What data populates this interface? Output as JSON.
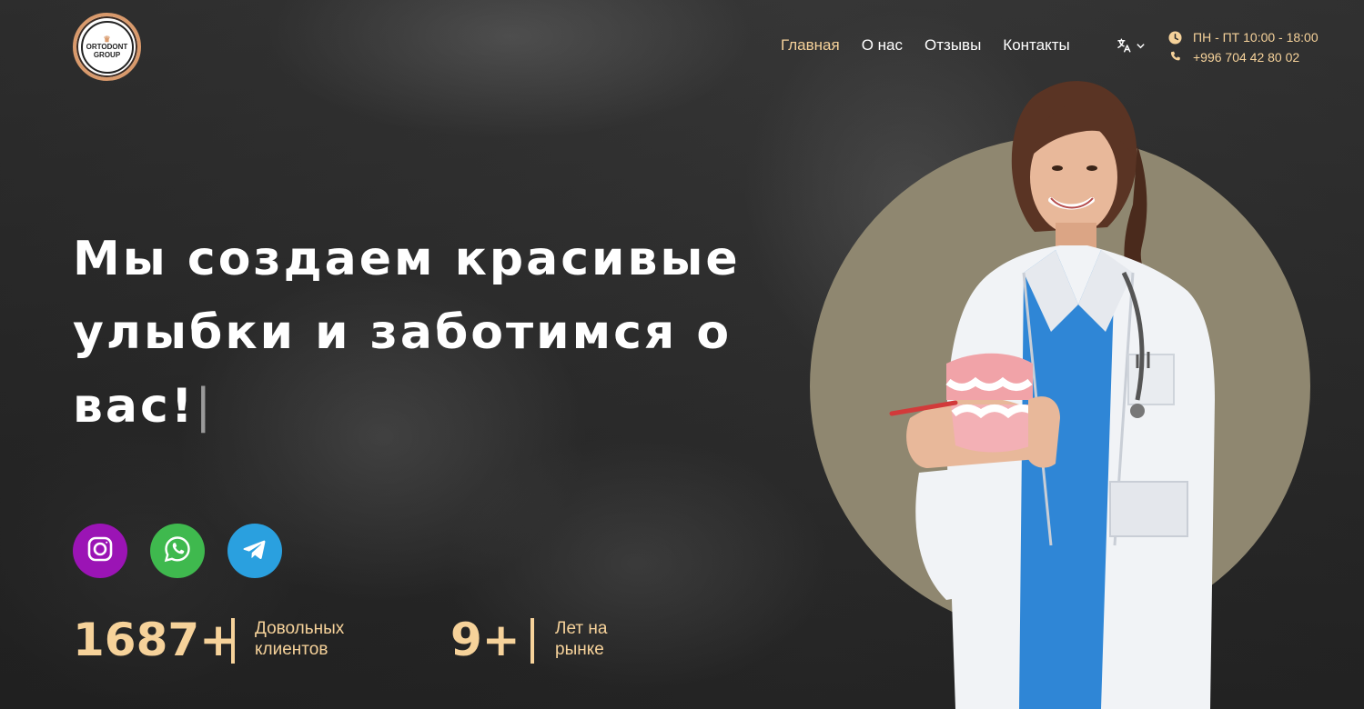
{
  "brand": {
    "logo_line1": "ORTODONT",
    "logo_line2": "GROUP"
  },
  "nav": {
    "items": [
      {
        "label": "Главная",
        "active": true
      },
      {
        "label": "О нас",
        "active": false
      },
      {
        "label": "Отзывы",
        "active": false
      },
      {
        "label": "Контакты",
        "active": false
      }
    ]
  },
  "language": {
    "icon": "translate-icon",
    "chevron": "chevron-down-icon"
  },
  "contacts": {
    "hours": "ПН - ПТ 10:00 - 18:00",
    "phone": "+996 704 42 80 02"
  },
  "hero": {
    "title_line1": "Мы создаем красивые",
    "title_line2": "улыбки и заботимся о",
    "title_line3": "вас!",
    "cursor": "|"
  },
  "socials": [
    {
      "name": "instagram-icon",
      "color": "#9b14b5"
    },
    {
      "name": "whatsapp-icon",
      "color": "#3fb94e"
    },
    {
      "name": "telegram-icon",
      "color": "#2aa0df"
    }
  ],
  "stats": [
    {
      "value": "1687+",
      "label_line1": "Довольных",
      "label_line2": "клиентов"
    },
    {
      "value": "9+",
      "label_line1": "Лет на",
      "label_line2": "рынке"
    }
  ],
  "colors": {
    "accent": "#f6d29a",
    "logo_ring": "#d99a6c",
    "circle": "#8f8770"
  }
}
